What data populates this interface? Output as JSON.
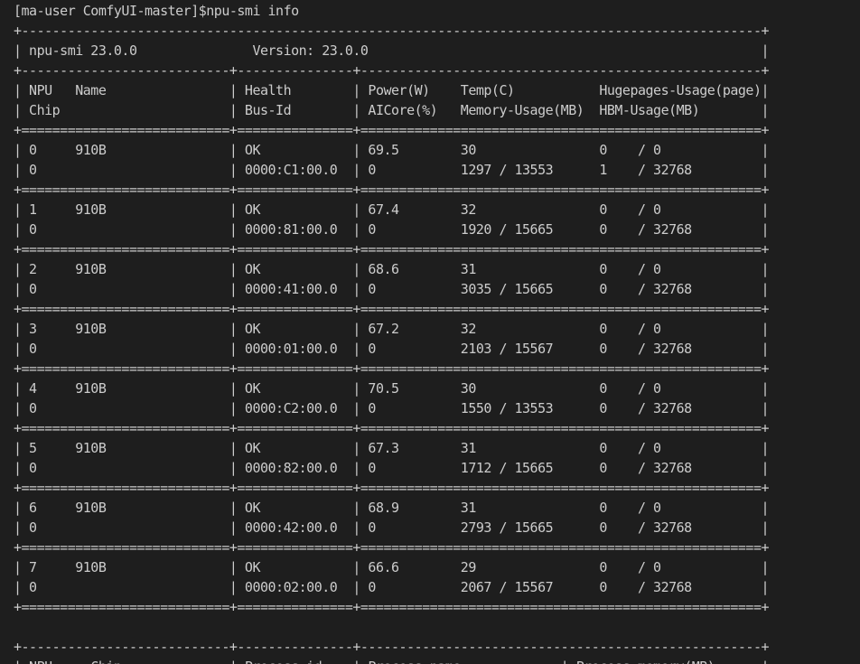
{
  "terminal": {
    "prompt": "[ma-user ComfyUI-master]$",
    "command": "npu-smi info",
    "lines": [
      "+------------------------------------------------------------------------------------------------+",
      "| npu-smi 23.0.0               Version: 23.0.0                                                   |",
      "+---------------------------+---------------+----------------------------------------------------+",
      "| NPU   Name                | Health        | Power(W)    Temp(C)           Hugepages-Usage(page)|",
      "| Chip                      | Bus-Id        | AICore(%)   Memory-Usage(MB)  HBM-Usage(MB)        |",
      "+===========================+===============+====================================================+",
      "| 0     910B                | OK            | 69.5        30                0    / 0             |",
      "| 0                         | 0000:C1:00.0  | 0           1297 / 13553      1    / 32768         |",
      "+===========================+===============+====================================================+",
      "| 1     910B                | OK            | 67.4        32                0    / 0             |",
      "| 0                         | 0000:81:00.0  | 0           1920 / 15665      0    / 32768         |",
      "+===========================+===============+====================================================+",
      "| 2     910B                | OK            | 68.6        31                0    / 0             |",
      "| 0                         | 0000:41:00.0  | 0           3035 / 15665      0    / 32768         |",
      "+===========================+===============+====================================================+",
      "| 3     910B                | OK            | 67.2        32                0    / 0             |",
      "| 0                         | 0000:01:00.0  | 0           2103 / 15567      0    / 32768         |",
      "+===========================+===============+====================================================+",
      "| 4     910B                | OK            | 70.5        30                0    / 0             |",
      "| 0                         | 0000:C2:00.0  | 0           1550 / 13553      0    / 32768         |",
      "+===========================+===============+====================================================+",
      "| 5     910B                | OK            | 67.3        31                0    / 0             |",
      "| 0                         | 0000:82:00.0  | 0           1712 / 15665      0    / 32768         |",
      "+===========================+===============+====================================================+",
      "| 6     910B                | OK            | 68.9        31                0    / 0             |",
      "| 0                         | 0000:42:00.0  | 0           2793 / 15665      0    / 32768         |",
      "+===========================+===============+====================================================+",
      "| 7     910B                | OK            | 66.6        29                0    / 0             |",
      "| 0                         | 0000:02:00.0  | 0           2067 / 15567      0    / 32768         |",
      "+===========================+===============+====================================================+",
      "",
      "+---------------------------+---------------+----------------------------------------------------+",
      "| NPU     Chip              | Process id    | Process name             | Process memory(MB)      |"
    ]
  },
  "colors": {
    "background": "#1e1e1e",
    "foreground": "#cccccc"
  }
}
